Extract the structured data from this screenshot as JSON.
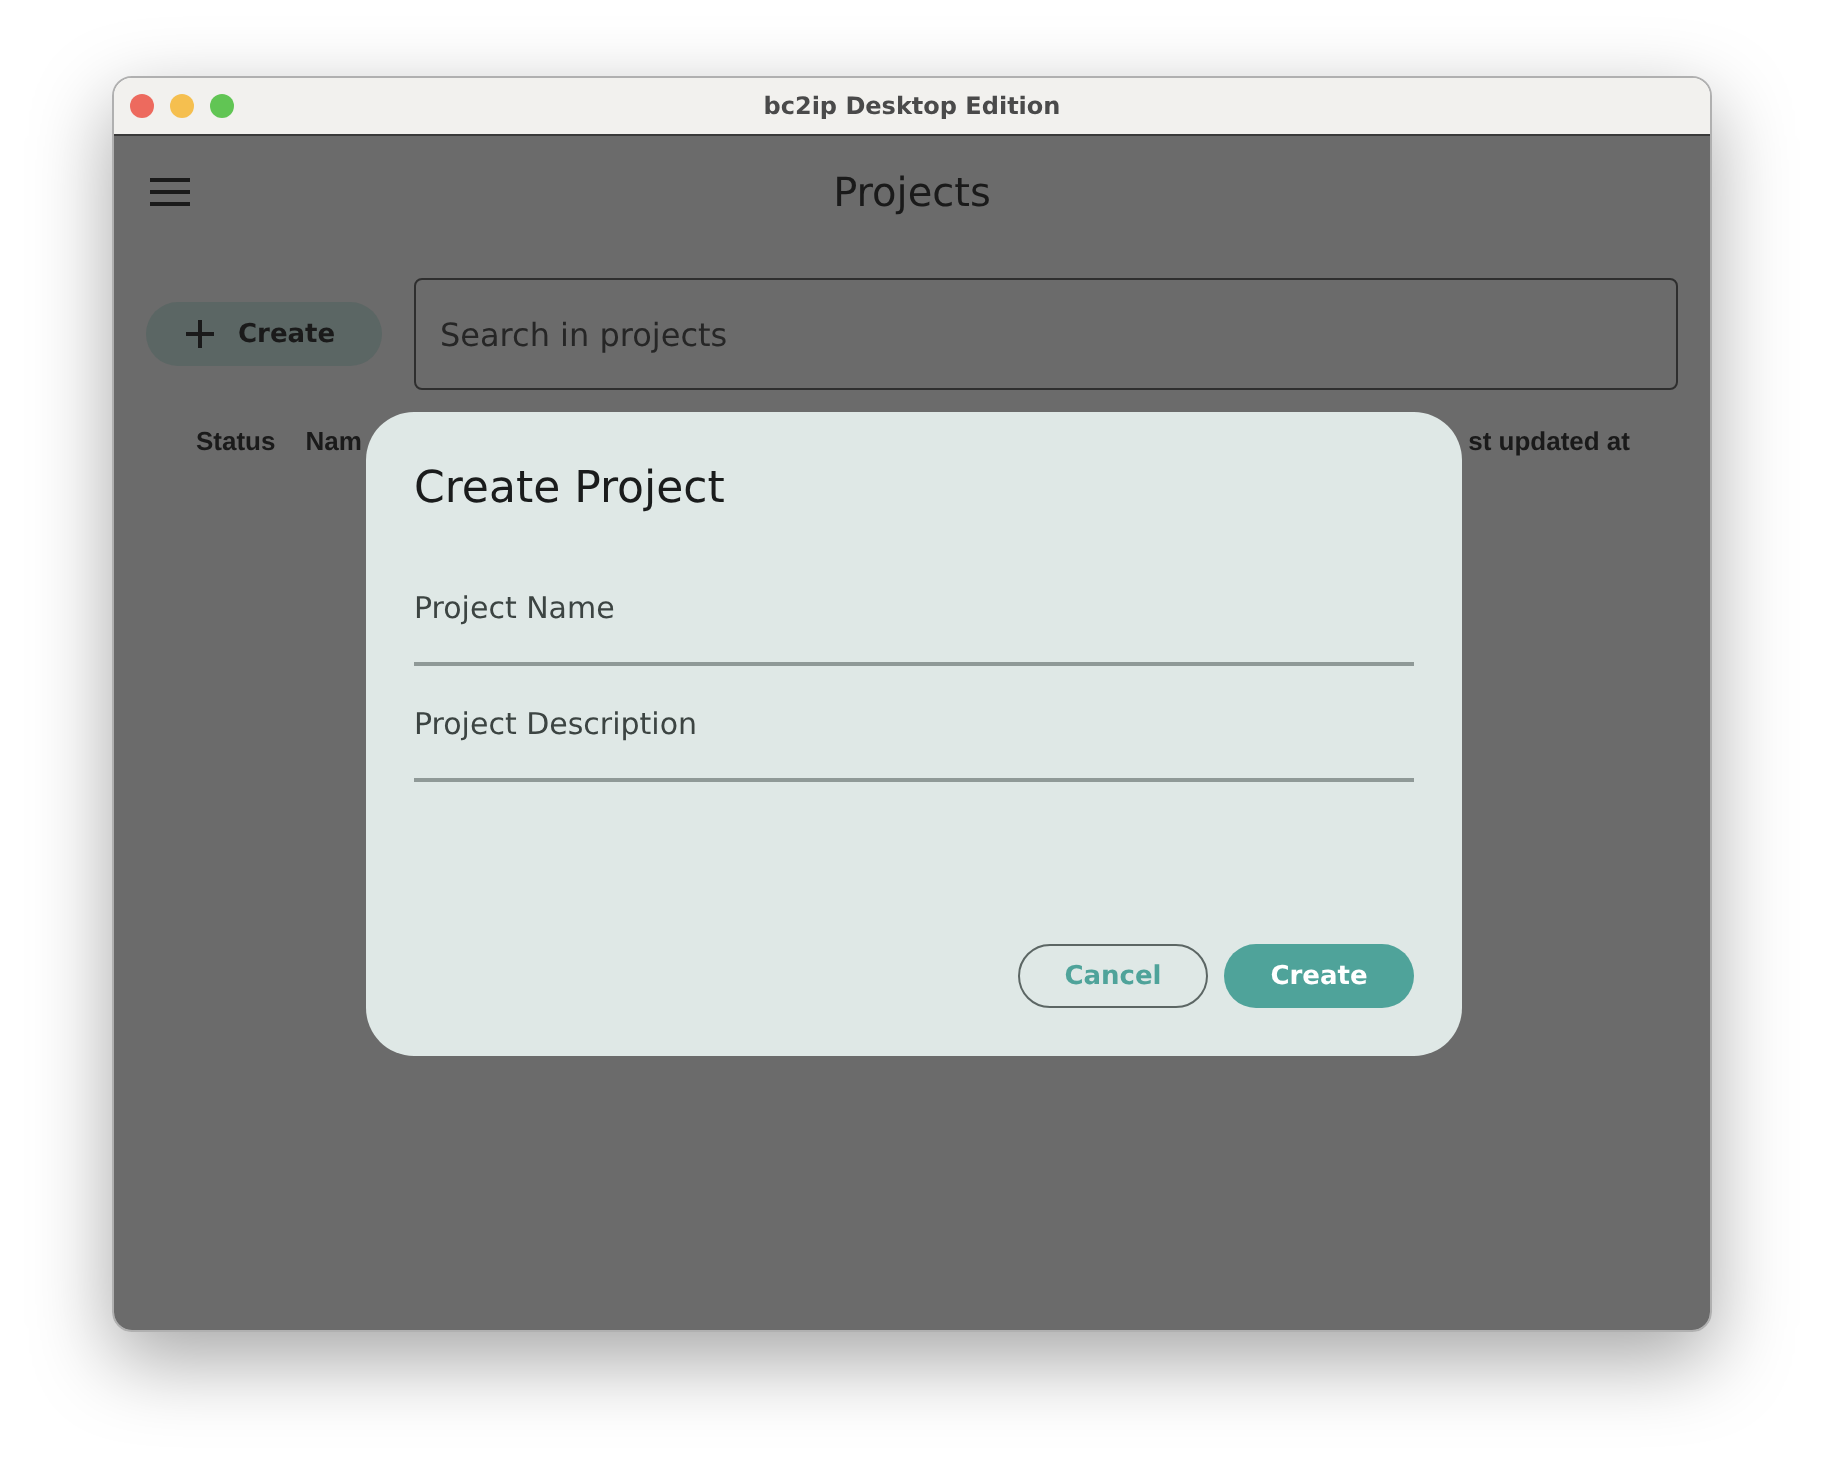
{
  "window": {
    "title": "bc2ip Desktop Edition"
  },
  "app_bar": {
    "title": "Projects"
  },
  "toolbar": {
    "create_button": "Create",
    "search": {
      "placeholder": "Search in projects"
    }
  },
  "table": {
    "columns": [
      "Status",
      "Nam",
      "st updated at"
    ]
  },
  "dialog": {
    "title": "Create Project",
    "fields": [
      {
        "placeholder": "Project Name"
      },
      {
        "placeholder": "Project Description"
      }
    ],
    "buttons": [
      {
        "label": "Cancel",
        "kind": "outlined"
      },
      {
        "label": "Create",
        "kind": "filled"
      }
    ]
  }
}
